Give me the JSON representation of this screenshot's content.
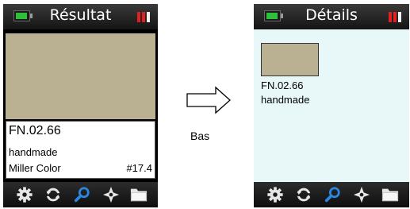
{
  "left_screen": {
    "title": "Résultat",
    "swatch_color": "#b9b192",
    "code": "FN.02.66",
    "name": "handmade",
    "brand": "Miller Color",
    "number": "#17.4",
    "status_icons": [
      "battery-icon",
      "signal-icon"
    ],
    "toolbar": [
      "gear-icon",
      "refresh-icon",
      "search-icon",
      "compass-icon",
      "folder-icon"
    ]
  },
  "transition": {
    "label": "Bas",
    "icon": "arrow-right-icon"
  },
  "right_screen": {
    "title": "Détails",
    "swatch_color": "#b9b192",
    "code": "FN.02.66",
    "name": "handmade",
    "status_icons": [
      "battery-icon",
      "signal-icon"
    ],
    "toolbar": [
      "gear-icon",
      "refresh-icon",
      "search-icon",
      "compass-icon",
      "folder-icon"
    ]
  },
  "colors": {
    "accent_search": "#2a86e0",
    "battery": "#2fbf3a",
    "signal": "#e32020",
    "detail_background": "#e8f7f7"
  }
}
